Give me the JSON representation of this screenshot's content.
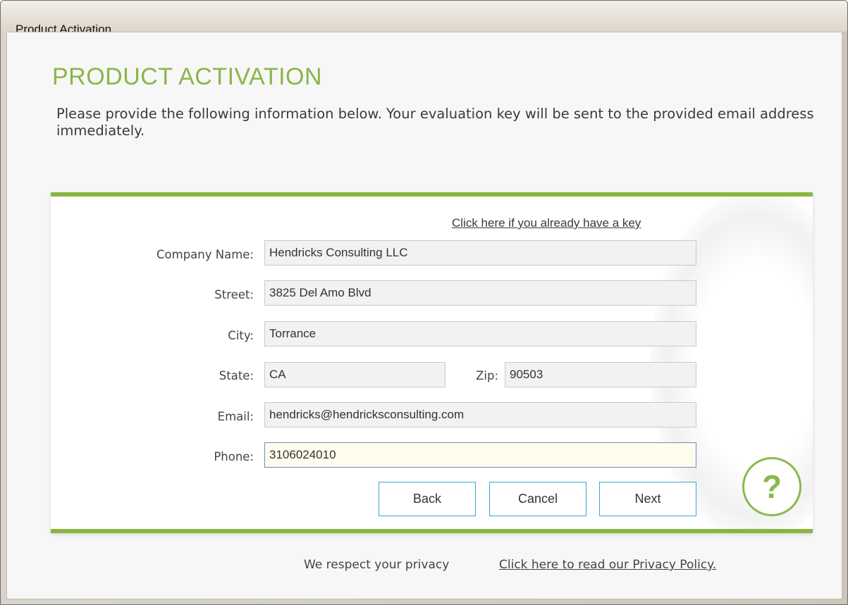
{
  "window": {
    "title": "Product Activation"
  },
  "header": {
    "title": "PRODUCT ACTIVATION",
    "intro": "Please provide the following information below. Your evaluation key will be sent to the provided email address immediately."
  },
  "form": {
    "key_link": "Click here if you already have a key",
    "company": {
      "label": "Company Name:",
      "value": "Hendricks Consulting LLC"
    },
    "street": {
      "label": "Street:",
      "value": "3825 Del Amo Blvd"
    },
    "city": {
      "label": "City:",
      "value": "Torrance"
    },
    "state": {
      "label": "State:",
      "value": "CA"
    },
    "zip": {
      "label": "Zip:",
      "value": "90503"
    },
    "email": {
      "label": "Email:",
      "value": "hendricks@hendricksconsulting.com"
    },
    "phone": {
      "label": "Phone:",
      "value": "3106024010"
    }
  },
  "buttons": {
    "back": "Back",
    "cancel": "Cancel",
    "next": "Next",
    "help": "?"
  },
  "footer": {
    "text": "We respect your privacy",
    "link": "Click here to read our Privacy Policy."
  },
  "colors": {
    "accent_green": "#88b63f",
    "button_border": "#3ea4cf",
    "active_field_bg": "#fefcea"
  }
}
